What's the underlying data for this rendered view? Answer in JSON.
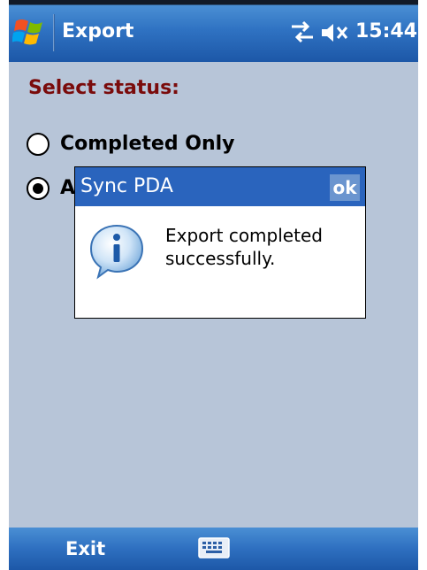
{
  "title_bar": {
    "app_title": "Export",
    "clock": "15:44",
    "icons": [
      "windows-start-icon",
      "connectivity-icon",
      "volume-muted-icon"
    ]
  },
  "content": {
    "heading": "Select status:",
    "options": [
      {
        "label": "Completed Only",
        "selected": false
      },
      {
        "label": "A",
        "selected": true
      }
    ]
  },
  "dialog": {
    "title": "Sync PDA",
    "ok_label": "ok",
    "icon": "info-icon",
    "message": "Export completed successfully."
  },
  "menu_bar": {
    "left_softkey": "Exit",
    "center_icon": "keyboard-icon"
  },
  "colors": {
    "title_bar": "#2f72c2",
    "content_background": "#b7c5d8",
    "heading_text": "#7a0b0b",
    "dialog_title_bar": "#2a64bd"
  }
}
